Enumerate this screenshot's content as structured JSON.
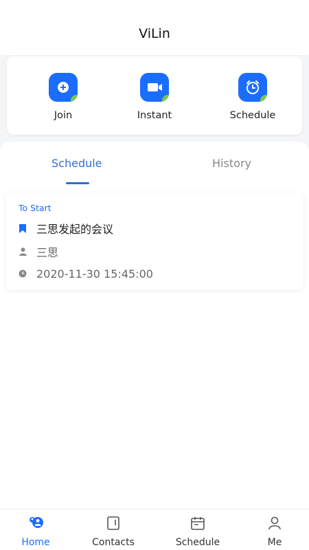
{
  "app": {
    "title": "ViLin"
  },
  "actions": [
    {
      "label": "Join",
      "icon": "join-plus-icon"
    },
    {
      "label": "Instant",
      "icon": "video-camera-icon"
    },
    {
      "label": "Schedule",
      "icon": "alarm-clock-icon"
    }
  ],
  "tabs": {
    "schedule": "Schedule",
    "history": "History"
  },
  "meeting": {
    "status": "To Start",
    "title": "三思发起的会议",
    "host": "三思",
    "datetime": "2020-11-30 15:45:00"
  },
  "nav": [
    {
      "label": "Home",
      "icon": "home-users-icon"
    },
    {
      "label": "Contacts",
      "icon": "contacts-book-icon"
    },
    {
      "label": "Schedule",
      "icon": "calendar-icon"
    },
    {
      "label": "Me",
      "icon": "person-icon"
    }
  ],
  "colors": {
    "accent": "#1a6dff",
    "tab_active": "#2f6fd6",
    "corner_green": "#7ac943"
  }
}
